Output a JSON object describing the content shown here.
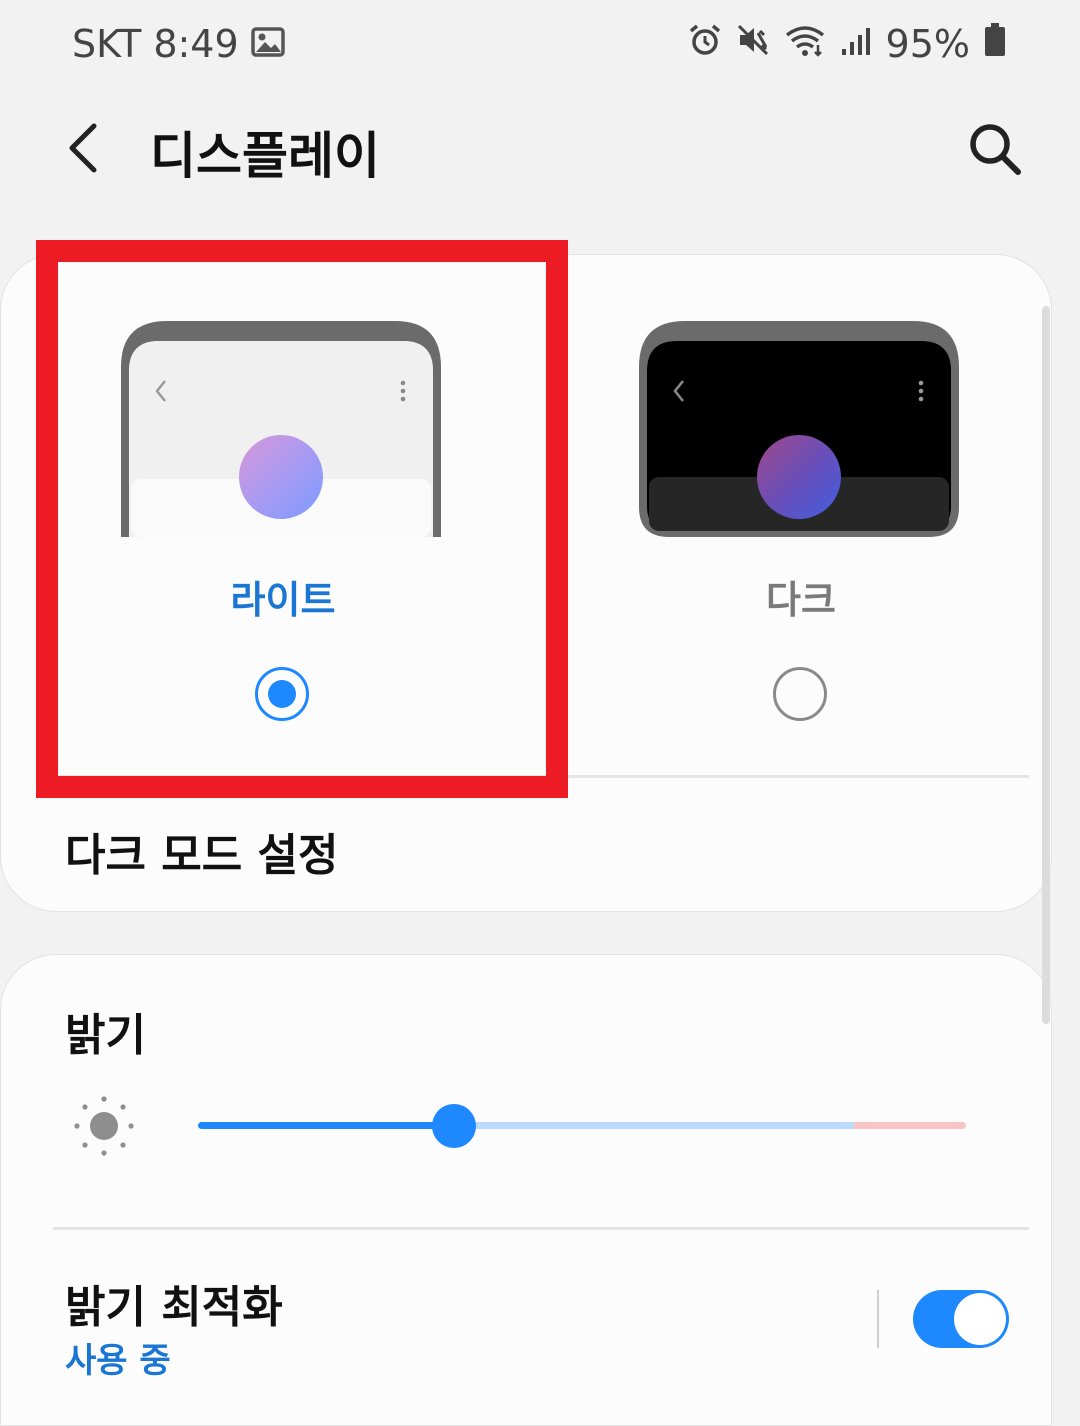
{
  "status_bar": {
    "carrier": "SKT",
    "time": "8:49",
    "battery": "95%"
  },
  "header": {
    "title": "디스플레이"
  },
  "theme": {
    "light_label": "라이트",
    "dark_label": "다크",
    "selected": "light"
  },
  "dark_mode_settings": {
    "label": "다크 모드 설정"
  },
  "brightness": {
    "label": "밝기",
    "level": 0.33
  },
  "adaptive_brightness": {
    "label": "밝기 최적화",
    "status": "사용 중",
    "enabled": true
  },
  "colors": {
    "accent": "#1e88ff",
    "highlight": "#ed1c24",
    "label_selected": "#1a76d2",
    "label_unselected": "#7a7a7a"
  }
}
